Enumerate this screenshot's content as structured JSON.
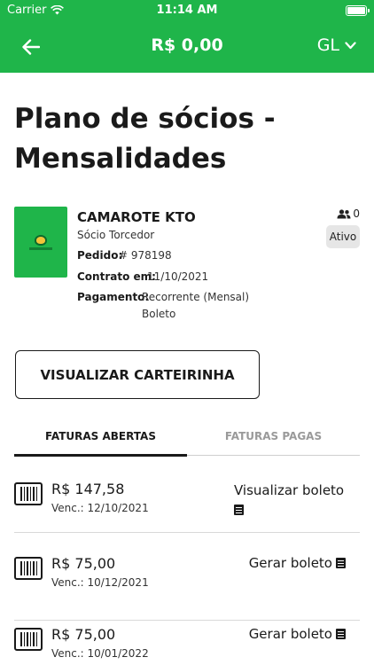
{
  "status_bar": {
    "carrier": "Carrier",
    "time": "11:14 AM"
  },
  "nav": {
    "balance": "R$ 0,00",
    "language": "GL"
  },
  "page": {
    "title": "Plano de sócios - Mensalidades"
  },
  "plan": {
    "name": "CAMAROTE KTO",
    "type": "Sócio Torcedor",
    "members_count": "0",
    "status": "Ativo",
    "order_label": "Pedido:",
    "order_value": "# 978198",
    "contract_label": "Contrato em:",
    "contract_value": "11/10/2021",
    "payment_label": "Pagamento:",
    "payment_value_line1": "Recorrente (Mensal)",
    "payment_value_line2": "Boleto"
  },
  "card_button": {
    "label": "VISUALIZAR CARTEIRINHA"
  },
  "tabs": [
    {
      "label": "FATURAS ABERTAS",
      "active": true
    },
    {
      "label": "FATURAS PAGAS",
      "active": false
    }
  ],
  "invoices": [
    {
      "amount": "R$ 147,58",
      "due": "Venc.: 12/10/2021",
      "action": "Visualizar boleto"
    },
    {
      "amount": "R$ 75,00",
      "due": "Venc.: 10/12/2021",
      "action": "Gerar boleto"
    },
    {
      "amount": "R$ 75,00",
      "due": "Venc.: 10/01/2022",
      "action": "Gerar boleto"
    }
  ],
  "colors": {
    "brand_green": "#1fb54a",
    "text_dark": "#1a1a1a",
    "muted_tab": "#9a9a9a",
    "badge_bg": "#e6e6e6"
  },
  "icons": [
    "wifi-icon",
    "battery-icon",
    "back-arrow-icon",
    "chevron-down-icon",
    "members-icon",
    "barcode-icon",
    "document-icon"
  ]
}
